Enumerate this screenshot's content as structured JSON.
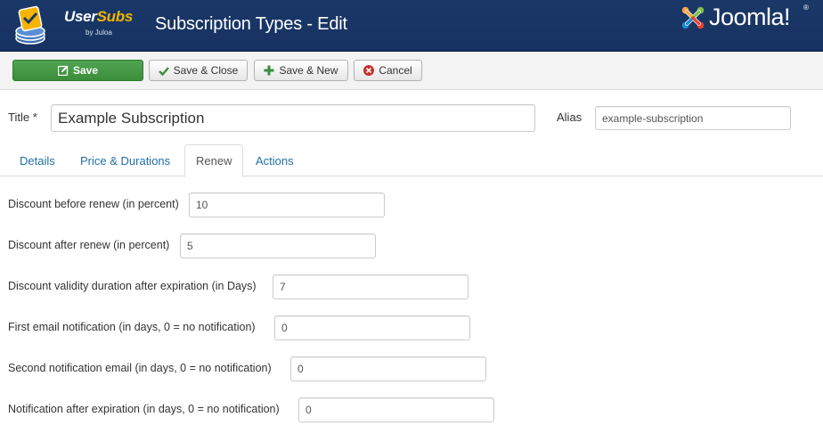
{
  "header": {
    "brand_user": "User",
    "brand_subs": "Subs",
    "brand_by": "by Juloa",
    "title": "Subscription Types - Edit",
    "joomla_text": "Joomla!",
    "joomla_reg": "®"
  },
  "toolbar": {
    "save_label": "Save",
    "save_close_label": "Save & Close",
    "save_new_label": "Save & New",
    "cancel_label": "Cancel"
  },
  "form": {
    "title_label": "Title *",
    "title_value": "Example Subscription",
    "alias_label": "Alias",
    "alias_value": "example-subscription"
  },
  "tabs": [
    {
      "label": "Details",
      "active": false
    },
    {
      "label": "Price & Durations",
      "active": false
    },
    {
      "label": "Renew",
      "active": true
    },
    {
      "label": "Actions",
      "active": false
    }
  ],
  "fields": [
    {
      "label": "Discount before renew (in percent)",
      "value": "10"
    },
    {
      "label": "Discount after renew (in percent)",
      "value": "5"
    },
    {
      "label": "Discount validity duration after expiration (in Days)",
      "value": "7"
    },
    {
      "label": "First email notification (in days, 0 = no notification)",
      "value": "0"
    },
    {
      "label": "Second notification email (in days, 0 = no notification)",
      "value": "0"
    },
    {
      "label": "Notification after expiration (in days, 0 = no notification)",
      "value": "0"
    }
  ],
  "colors": {
    "header_bg": "#1a3867",
    "save_green": "#51a351",
    "link_blue": "#1f6fa8",
    "cancel_red": "#c9302c",
    "save_new_green": "#3a8e3a",
    "brand_gold": "#f4b400"
  },
  "icons": {
    "brand": "usersubs-logo-icon",
    "joomla": "joomla-logo-icon",
    "save": "edit-icon",
    "save_close": "check-icon",
    "save_new": "plus-icon",
    "cancel": "cancel-circle-icon"
  }
}
